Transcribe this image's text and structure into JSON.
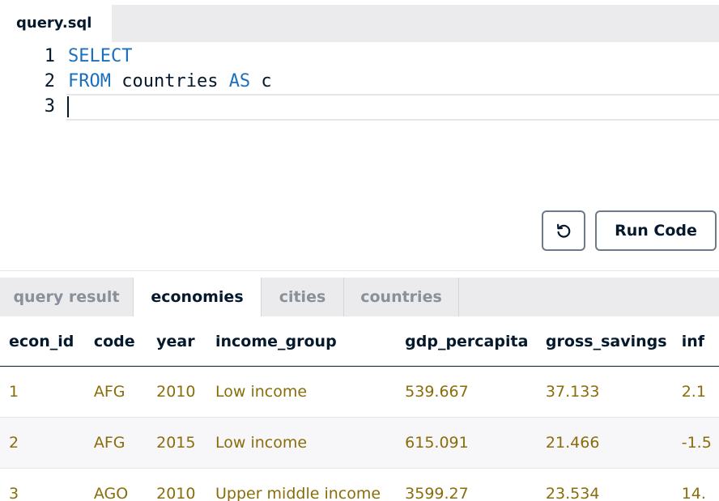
{
  "editor": {
    "file_tab": "query.sql",
    "lines": [
      {
        "num": "1",
        "kw1": "SELECT",
        "rest": "",
        "kw2": "",
        "tail": ""
      },
      {
        "num": "2",
        "kw1": "FROM",
        "rest": " countries ",
        "kw2": "AS",
        "tail": " c"
      },
      {
        "num": "3",
        "kw1": "",
        "rest": "",
        "kw2": "",
        "tail": ""
      }
    ],
    "icons": {
      "reset": "reset-arrow-icon"
    }
  },
  "buttons": {
    "run_label": "Run Code"
  },
  "results": {
    "tabs": [
      "query result",
      "economies",
      "cities",
      "countries"
    ],
    "active_tab": "economies",
    "columns": [
      "econ_id",
      "code",
      "year",
      "income_group",
      "gdp_percapita",
      "gross_savings",
      "inf"
    ],
    "rows": [
      [
        "1",
        "AFG",
        "2010",
        "Low income",
        "539.667",
        "37.133",
        "2.1"
      ],
      [
        "2",
        "AFG",
        "2015",
        "Low income",
        "615.091",
        "21.466",
        "-1.5"
      ],
      [
        "3",
        "AGO",
        "2010",
        "Upper middle income",
        "3599.27",
        "23.534",
        "14."
      ]
    ]
  },
  "colors": {
    "keyword": "#1a6fbf",
    "cell_text": "#8a6d0b",
    "dark_text": "#05192d",
    "tab_bar": "#ebebee"
  }
}
